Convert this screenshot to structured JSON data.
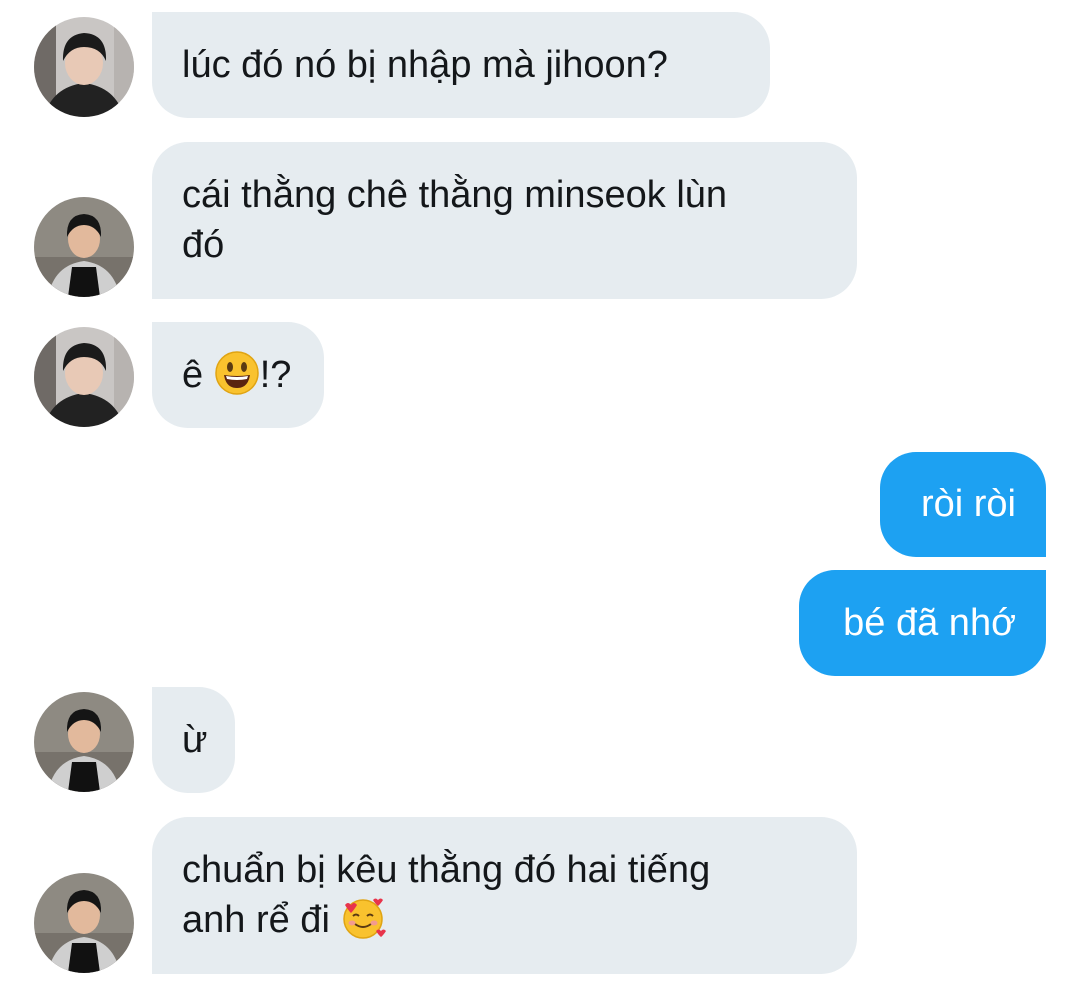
{
  "messages": [
    {
      "sender": "other",
      "avatar": "avatar-a",
      "text": "lúc đó nó bị nhập mà jihoon?"
    },
    {
      "sender": "other",
      "avatar": "avatar-b",
      "line1": "cái thằng chê thằng minseok lùn",
      "line2": "đó"
    },
    {
      "sender": "other",
      "avatar": "avatar-a",
      "before": "ê ",
      "emoji": "grinning-face-emoji",
      "after": "!?"
    },
    {
      "sender": "me",
      "text": "ròi ròi"
    },
    {
      "sender": "me",
      "text": "bé đã nhớ"
    },
    {
      "sender": "other",
      "avatar": "avatar-b",
      "text": "ừ"
    },
    {
      "sender": "other",
      "avatar": "avatar-b",
      "line1": "chuẩn bị kêu thằng đó hai tiếng",
      "line2": "anh rể đi ",
      "emoji": "smiling-face-with-hearts-emoji"
    }
  ],
  "colors": {
    "incoming_bubble": "#e6ecf0",
    "outgoing_bubble": "#1da1f2",
    "incoming_text": "#14171a",
    "outgoing_text": "#ffffff"
  }
}
